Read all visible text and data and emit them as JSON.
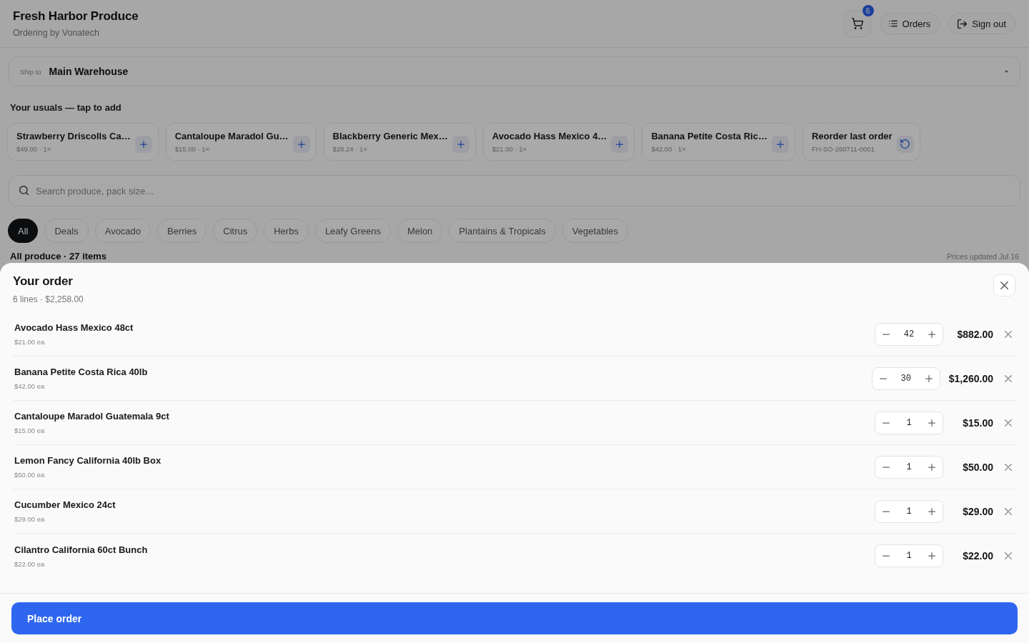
{
  "header": {
    "title": "Fresh Harbor Produce",
    "subtitle": "Ordering by Vonatech",
    "cart_count": "6",
    "buttons": [
      {
        "kind": "orders",
        "label": "Orders"
      },
      {
        "kind": "sign_out",
        "label": "Sign out"
      }
    ]
  },
  "ship_to": {
    "label": "Ship to",
    "value": "Main Warehouse"
  },
  "usuals": {
    "heading": "Your usuals — tap to add",
    "items": [
      {
        "kind": "product",
        "name": "Strawberry Driscolls Ca…",
        "detail": "$49.00 · 1×"
      },
      {
        "kind": "product",
        "name": "Cantaloupe Maradol Gu…",
        "detail": "$15.00 · 1×"
      },
      {
        "kind": "product",
        "name": "Blackberry Generic Mex…",
        "detail": "$26.24 · 1×"
      },
      {
        "kind": "product",
        "name": "Avocado Hass Mexico 4…",
        "detail": "$21.00 · 1×"
      },
      {
        "kind": "product",
        "name": "Banana Petite Costa Ric…",
        "detail": "$42.00 · 1×"
      },
      {
        "kind": "reorder",
        "name": "Reorder last order",
        "detail": "FH-SO-260711-0001"
      }
    ]
  },
  "search": {
    "placeholder": "Search produce, pack size…"
  },
  "categories": [
    {
      "label": "All",
      "selected": true
    },
    {
      "label": "Deals",
      "selected": false
    },
    {
      "label": "Avocado",
      "selected": false
    },
    {
      "label": "Berries",
      "selected": false
    },
    {
      "label": "Citrus",
      "selected": false
    },
    {
      "label": "Herbs",
      "selected": false
    },
    {
      "label": "Leafy Greens",
      "selected": false
    },
    {
      "label": "Melon",
      "selected": false
    },
    {
      "label": "Plantains & Tropicals",
      "selected": false
    },
    {
      "label": "Vegetables",
      "selected": false
    }
  ],
  "catalog": {
    "count": "All produce · 27 items",
    "updated": "Prices updated Jul 16"
  },
  "order": {
    "title": "Your order",
    "summary": "6 lines · $2,258.00",
    "lines": [
      {
        "name": "Avocado Hass Mexico 48ct",
        "unit_price": "$21.00 ea",
        "quantity": "42",
        "total": "$882.00"
      },
      {
        "name": "Banana Petite Costa Rica 40lb",
        "unit_price": "$42.00 ea",
        "quantity": "30",
        "total": "$1,260.00"
      },
      {
        "name": "Cantaloupe Maradol Guatemala 9ct",
        "unit_price": "$15.00 ea",
        "quantity": "1",
        "total": "$15.00"
      },
      {
        "name": "Lemon Fancy California 40lb Box",
        "unit_price": "$50.00 ea",
        "quantity": "1",
        "total": "$50.00"
      },
      {
        "name": "Cucumber Mexico 24ct",
        "unit_price": "$29.00 ea",
        "quantity": "1",
        "total": "$29.00"
      },
      {
        "name": "Cilantro California 60ct Bunch",
        "unit_price": "$22.00 ea",
        "quantity": "1",
        "total": "$22.00"
      }
    ],
    "submit": "Place order"
  }
}
